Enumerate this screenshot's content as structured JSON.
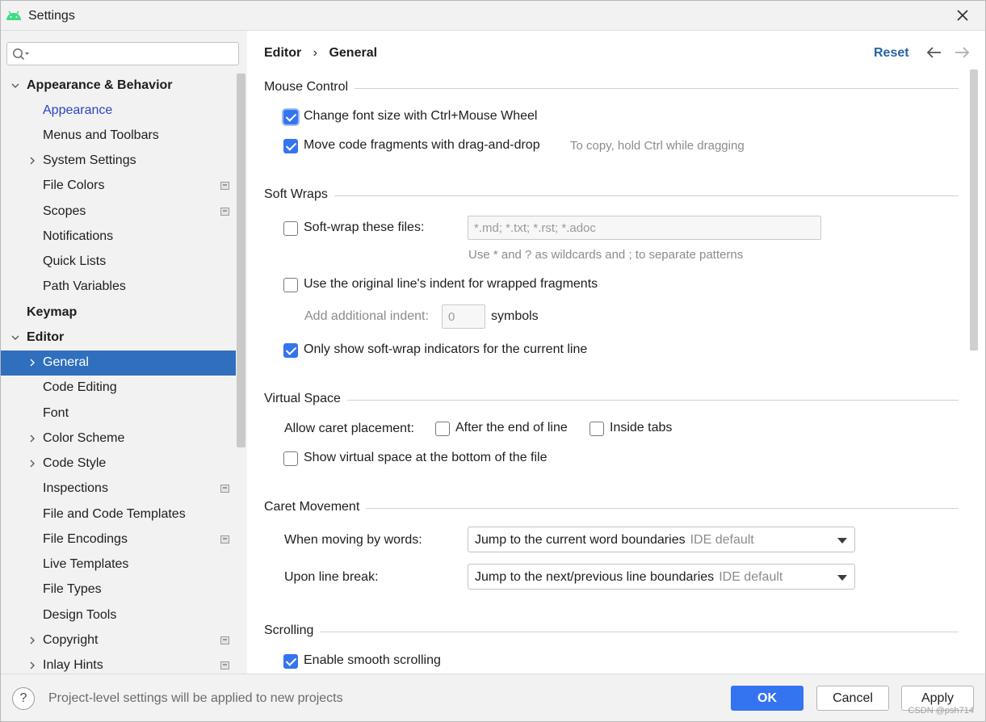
{
  "window": {
    "title": "Settings",
    "app_icon": "android-icon",
    "close_icon": "close-icon"
  },
  "sidebar": {
    "search": {
      "value": "",
      "placeholder": ""
    },
    "items": [
      {
        "label": "Appearance & Behavior",
        "chevron": "expanded"
      },
      {
        "label": "Appearance"
      },
      {
        "label": "Menus and Toolbars"
      },
      {
        "label": "System Settings",
        "chevron": "collapsed"
      },
      {
        "label": "File Colors",
        "project_icon": true
      },
      {
        "label": "Scopes",
        "project_icon": true
      },
      {
        "label": "Notifications"
      },
      {
        "label": "Quick Lists"
      },
      {
        "label": "Path Variables"
      },
      {
        "label": "Keymap"
      },
      {
        "label": "Editor",
        "chevron": "expanded"
      },
      {
        "label": "General",
        "chevron": "collapsed",
        "selected": true
      },
      {
        "label": "Code Editing"
      },
      {
        "label": "Font"
      },
      {
        "label": "Color Scheme",
        "chevron": "collapsed"
      },
      {
        "label": "Code Style",
        "chevron": "collapsed"
      },
      {
        "label": "Inspections",
        "project_icon": true
      },
      {
        "label": "File and Code Templates"
      },
      {
        "label": "File Encodings",
        "project_icon": true
      },
      {
        "label": "Live Templates"
      },
      {
        "label": "File Types"
      },
      {
        "label": "Design Tools"
      },
      {
        "label": "Copyright",
        "chevron": "collapsed",
        "project_icon": true
      },
      {
        "label": "Inlay Hints",
        "chevron": "collapsed",
        "project_icon": true
      }
    ]
  },
  "header": {
    "breadcrumb": [
      "Editor",
      "›",
      "General"
    ],
    "reset_label": "Reset",
    "back_icon": "arrow-left-icon",
    "forward_icon": "arrow-right-icon"
  },
  "mouse_control": {
    "title": "Mouse Control",
    "font_size_wheel": {
      "label": "Change font size with Ctrl+Mouse Wheel",
      "checked": true
    },
    "drag_drop": {
      "label": "Move code fragments with drag-and-drop",
      "checked": true,
      "hint": "To copy, hold Ctrl while dragging"
    }
  },
  "soft_wraps": {
    "title": "Soft Wraps",
    "soft_wrap_files": {
      "label": "Soft-wrap these files:",
      "checked": false,
      "value": "*.md; *.txt; *.rst; *.adoc"
    },
    "patterns_hint": "Use * and ? as wildcards and ; to separate patterns",
    "original_indent": {
      "label": "Use the original line's indent for wrapped fragments",
      "checked": false
    },
    "additional_indent_label": "Add additional indent:",
    "additional_indent_value": "0",
    "symbols_label": "symbols",
    "indicators_current_line": {
      "label": "Only show soft-wrap indicators for the current line",
      "checked": true
    }
  },
  "virtual_space": {
    "title": "Virtual Space",
    "caret_placement_label": "Allow caret placement:",
    "after_end_of_line": {
      "label": "After the end of line",
      "checked": false
    },
    "inside_tabs": {
      "label": "Inside tabs",
      "checked": false
    },
    "show_virtual_bottom": {
      "label": "Show virtual space at the bottom of the file",
      "checked": false
    }
  },
  "caret_movement": {
    "title": "Caret Movement",
    "by_words_label": "When moving by words:",
    "by_words_value": "Jump to the current word boundaries",
    "by_words_default": "IDE default",
    "line_break_label": "Upon line break:",
    "line_break_value": "Jump to the next/previous line boundaries",
    "line_break_default": "IDE default"
  },
  "scrolling": {
    "title": "Scrolling",
    "smooth": {
      "label": "Enable smooth scrolling",
      "checked": true
    }
  },
  "footer": {
    "help_label": "?",
    "message": "Project-level settings will be applied to new projects",
    "ok_label": "OK",
    "cancel_label": "Cancel",
    "apply_label": "Apply",
    "watermark": "CSDN @psh714"
  },
  "colors": {
    "accent": "#3574f0",
    "selection": "#2f6fbd",
    "link": "#2563a6"
  }
}
